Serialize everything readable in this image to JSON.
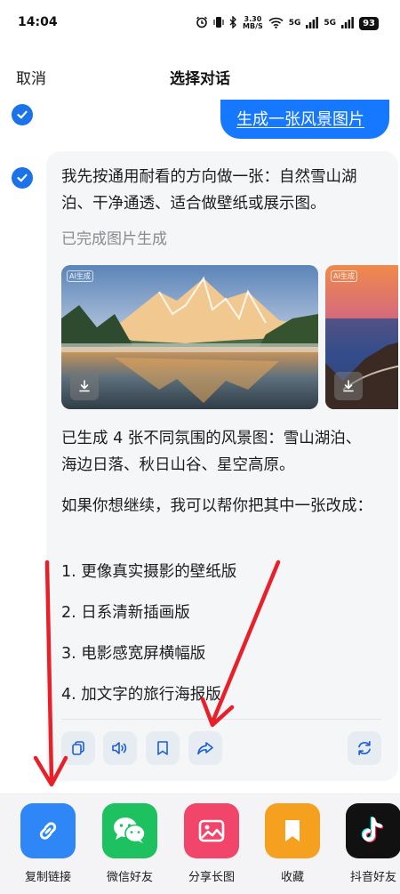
{
  "status_bar": {
    "time": "14:04",
    "network_speed_value": "3.30",
    "network_speed_unit": "MB/S",
    "signal_label": "5G",
    "battery": "93"
  },
  "header": {
    "cancel_label": "取消",
    "title": "选择对话"
  },
  "user_message": {
    "text": "生成一张风景图片",
    "selected": true
  },
  "ai_message": {
    "selected": true,
    "intro": "我先按通用耐看的方向做一张：自然雪山湖泊、干净通透、适合做壁纸或展示图。",
    "status": "已完成图片生成",
    "images": [
      {
        "tag": "AI生成",
        "icon": "download-icon"
      },
      {
        "tag": "AI生成",
        "icon": "download-icon"
      }
    ],
    "summary": "已生成 4 张不同氛围的风景图：雪山湖泊、海边日落、秋日山谷、星空高原。",
    "followup": "如果你想继续，我可以帮你把其中一张改成：",
    "options": [
      "1. 更像真实摄影的壁纸版",
      "2. 日系清新插画版",
      "3. 电影感宽屏横幅版",
      "4. 加文字的旅行海报版"
    ],
    "actions": [
      "copy-icon",
      "speaker-icon",
      "bookmark-icon",
      "share-icon",
      "regenerate-icon"
    ]
  },
  "share_sheet": {
    "items": [
      {
        "label": "复制链接",
        "icon": "link-icon",
        "color": "#2f86f6"
      },
      {
        "label": "微信好友",
        "icon": "wechat-icon",
        "color": "#1ec15f"
      },
      {
        "label": "分享长图",
        "icon": "image-icon",
        "color": "#f2456a"
      },
      {
        "label": "收藏",
        "icon": "bookmark-icon",
        "color": "#f6a020"
      },
      {
        "label": "抖音好友",
        "icon": "douyin-icon",
        "color": "#111111"
      }
    ]
  },
  "colors": {
    "accent": "#1677ff",
    "annotation_arrow": "#e8202a"
  }
}
